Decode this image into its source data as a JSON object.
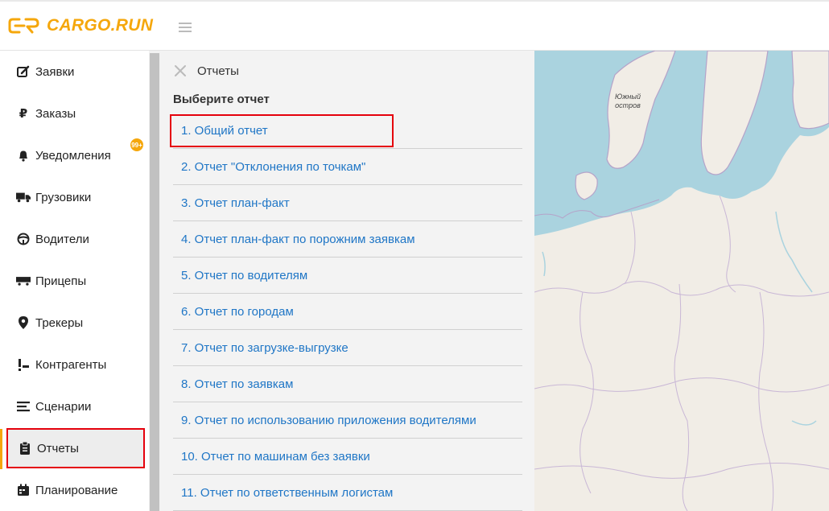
{
  "brand": {
    "name": "CARGO.RUN",
    "accent": "#f5a70c"
  },
  "sidebar": {
    "items": [
      {
        "label": "Заявки",
        "icon": "edit-icon"
      },
      {
        "label": "Заказы",
        "icon": "ruble-icon"
      },
      {
        "label": "Уведомления",
        "icon": "bell-icon",
        "badge": "99+"
      },
      {
        "label": "Грузовики",
        "icon": "truck-icon"
      },
      {
        "label": "Водители",
        "icon": "steering-wheel-icon"
      },
      {
        "label": "Прицепы",
        "icon": "trailer-icon"
      },
      {
        "label": "Трекеры",
        "icon": "map-marker-icon"
      },
      {
        "label": "Контрагенты",
        "icon": "contacts-icon"
      },
      {
        "label": "Сценарии",
        "icon": "list-icon"
      },
      {
        "label": "Отчеты",
        "icon": "clipboard-icon",
        "active": true
      },
      {
        "label": "Планирование",
        "icon": "calendar-icon"
      }
    ]
  },
  "panel": {
    "title": "Отчеты",
    "subtitle": "Выберите отчет",
    "reports": [
      "1. Общий отчет",
      "2. Отчет \"Отклонения по точкам\"",
      "3. Отчет план-факт",
      "4. Отчет план-факт по порожним заявкам",
      "5. Отчет по водителям",
      "6. Отчет по городам",
      "7. Отчет по загрузке-выгрузке",
      "8. Отчет по заявкам",
      "9. Отчет по использованию приложения водителями",
      "10. Отчет по машинам без заявки",
      "11. Отчет по ответственным логистам"
    ]
  },
  "map": {
    "label_line1": "Южный",
    "label_line2": "остров"
  }
}
